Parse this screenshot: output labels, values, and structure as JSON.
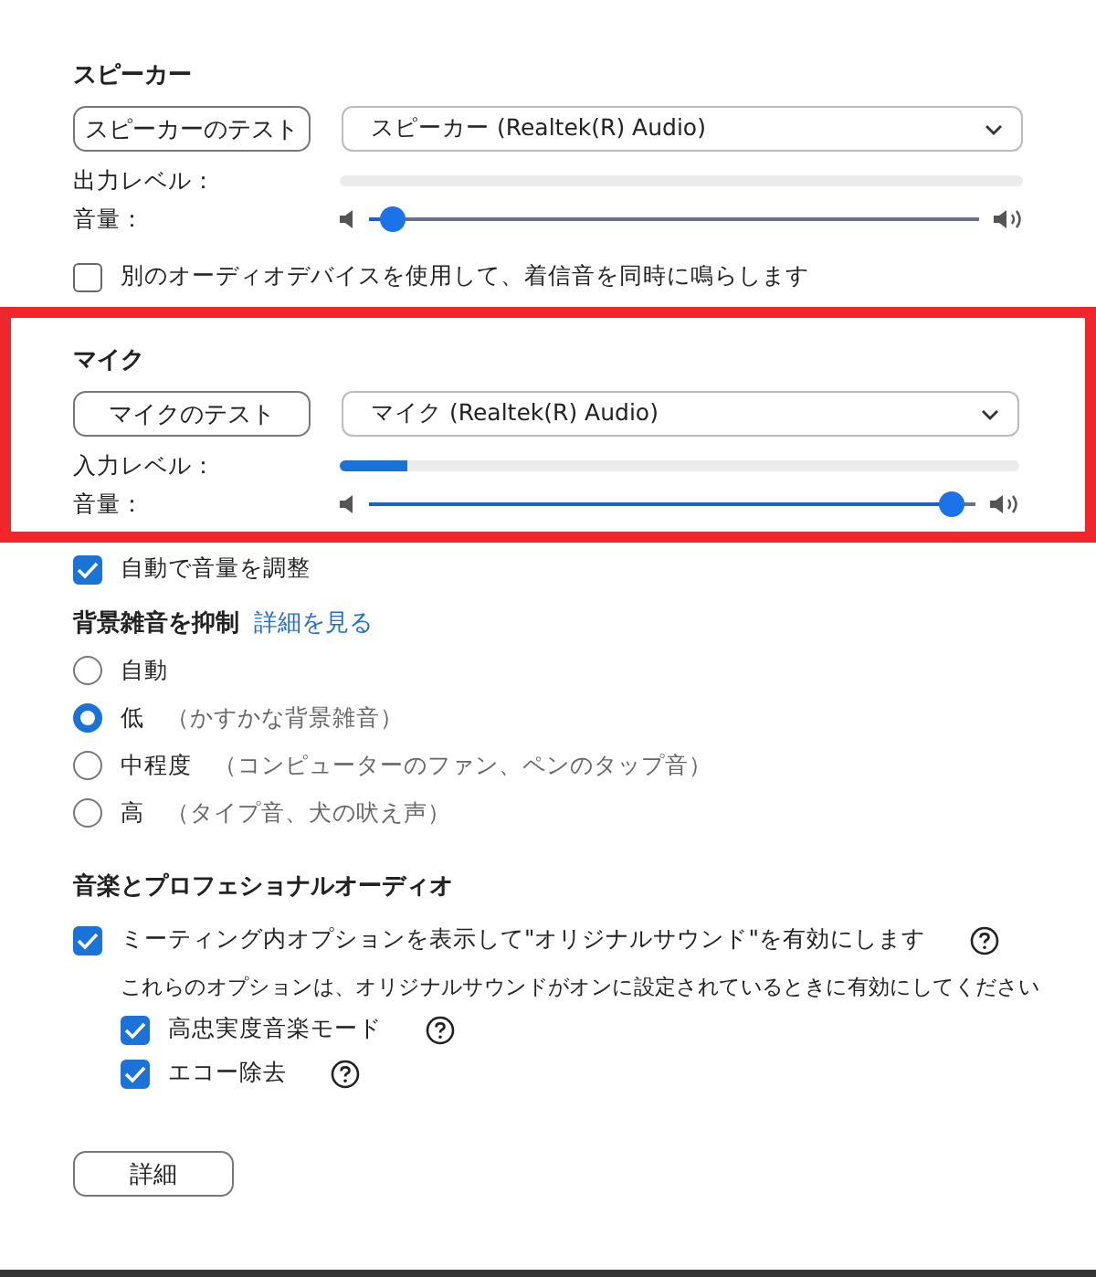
{
  "speaker": {
    "heading": "スピーカー",
    "test_button": "スピーカーのテスト",
    "device": "スピーカー (Realtek(R) Audio)",
    "output": {
      "label": "出力レベル："
    },
    "volume": {
      "label": "音量：",
      "level": 0.02
    },
    "highlighted": false
  },
  "ring_option": {
    "label": "別のオーディオデバイスを使用して、着信音を同時に鳴らします",
    "checked": false
  },
  "mic": {
    "heading": "マイク",
    "test_button": "マイクのテスト",
    "device": "マイク (Realtek(R) Audio)",
    "output": {
      "label": "入力レベル：",
      "level": 0.1
    },
    "volume": {
      "label": "音量：",
      "level": 0.98
    },
    "highlighted": true
  },
  "auto_volume": {
    "label": "自動で音量を調整",
    "checked": true
  },
  "noise": {
    "heading": "背景雑音を抑制",
    "link": "詳細を見る",
    "options": [
      {
        "label": "自動",
        "selected": false
      },
      {
        "label": "低",
        "note": "（かすかな背景雑音）",
        "selected": true
      },
      {
        "label": "中程度",
        "note": "（コンピューターのファン、ペンのタップ音）",
        "selected": false
      },
      {
        "label": "高",
        "note": "（タイプ音、犬の吠え声）",
        "selected": false
      }
    ]
  },
  "music": {
    "heading": "音楽とプロフェショナルオーディオ",
    "original_sound": {
      "label": "ミーティング内オプションを表示して\"オリジナルサウンド\"を有効にします",
      "checked": true
    },
    "note": "これらのオプションは、オリジナルサウンドがオンに設定されているときに有効にしてください",
    "options": [
      {
        "label": "高忠実度音楽モード",
        "checked": true
      },
      {
        "label": "エコー除去",
        "checked": true
      }
    ]
  },
  "advanced_button": "詳細"
}
